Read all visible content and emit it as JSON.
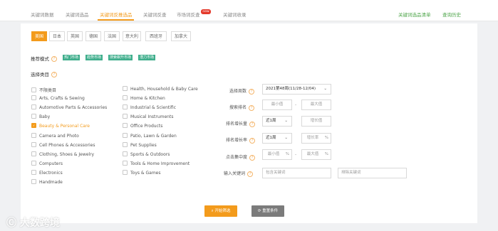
{
  "tabs": [
    {
      "label": "关键词数据"
    },
    {
      "label": "关键词选品"
    },
    {
      "label": "关键词反推选品",
      "active": true
    },
    {
      "label": "关键词反查"
    },
    {
      "label": "市场词反查"
    },
    {
      "label": "关键词收录"
    }
  ],
  "new_badge": "new",
  "header_links": {
    "list": "关键词选品清单",
    "history": "查询历史"
  },
  "countries": [
    "美国",
    "日本",
    "英国",
    "德国",
    "法国",
    "意大利",
    "西班牙",
    "加拿大"
  ],
  "selected_country": "美国",
  "recommend": {
    "label": "推荐模式",
    "modes": [
      "热门市场",
      "趋势市场",
      "搜索飙升市场",
      "潜力市场"
    ]
  },
  "category": {
    "label": "选择类目",
    "col1": [
      "不限类目",
      "Arts, Crafts & Sewing",
      "Automotive Parts & Accessories",
      "Baby",
      "Beauty & Personal Care",
      "Camera and Photo",
      "Cell Phones & Accessories",
      "Clothing, Shoes & Jewelry",
      "Computers",
      "Electronics",
      "Handmade"
    ],
    "col2": [
      "Health, Household & Baby Care",
      "Home & Kitchen",
      "Industrial & Scientific",
      "Musical Instruments",
      "Office Products",
      "Patio, Lawn & Garden",
      "Pet Supplies",
      "Sports & Outdoors",
      "Tools & Home Improvement",
      "Toys & Games"
    ],
    "checked": "Beauty & Personal Care"
  },
  "filters": {
    "period": {
      "label": "选择周数",
      "value": "2021第48周(11/28-12/04)"
    },
    "rank": {
      "label": "搜索排名",
      "min": "最小值",
      "max": "最大值"
    },
    "growth": {
      "label": "排名增长量",
      "recent": "近1周",
      "ph": "增长值"
    },
    "rate": {
      "label": "排名增长率",
      "recent": "近1周",
      "ph": "增长率",
      "unit": "%"
    },
    "concentration": {
      "label": "点击集中度",
      "min": "最小值",
      "max": "最大值",
      "unit": "%"
    },
    "keyword": {
      "label": "输入关键词",
      "include_ph": "包含关键词",
      "exclude_ph": "排除关键词"
    }
  },
  "buttons": {
    "search": "开始筛选",
    "reset": "重置条件"
  },
  "watermark": "大数跨境"
}
